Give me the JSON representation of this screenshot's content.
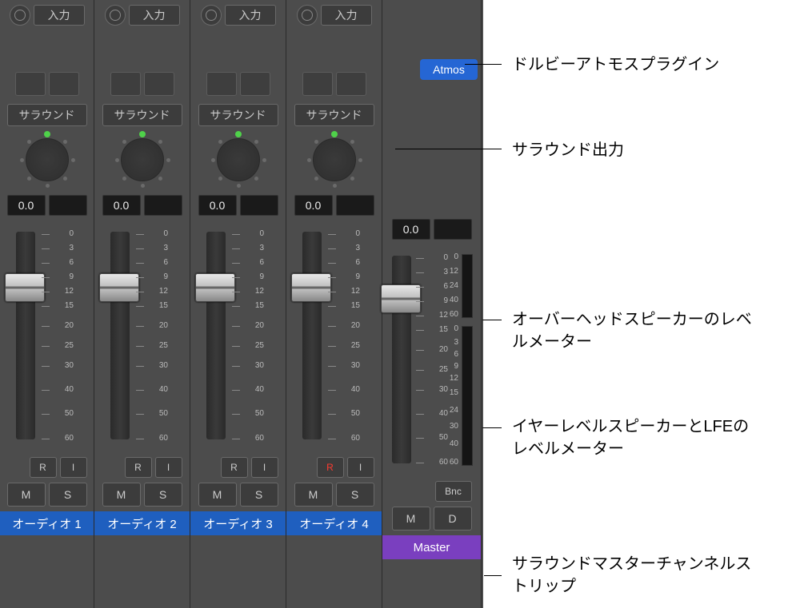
{
  "top": {
    "input_label": "入力"
  },
  "surround_label": "サラウンド",
  "gain_value": "0.0",
  "atmos_label": "Atmos",
  "scale_marks": [
    "0",
    "3",
    "6",
    "9",
    "12",
    "15",
    "20",
    "25",
    "30",
    "40",
    "50",
    "60"
  ],
  "master_scale_top": [
    "0",
    "12",
    "24",
    "40",
    "60"
  ],
  "master_scale_bottom": [
    "0",
    "3",
    "6",
    "9",
    "12",
    "15",
    "24",
    "30",
    "40",
    "60"
  ],
  "buttons": {
    "R": "R",
    "I": "I",
    "M": "M",
    "S": "S",
    "D": "D",
    "Bnc": "Bnc"
  },
  "names": {
    "audio1": "オーディオ 1",
    "audio2": "オーディオ 2",
    "audio3": "オーディオ 3",
    "audio4": "オーディオ 4",
    "master": "Master"
  },
  "callouts": {
    "atmos": "ドルビーアトモスプラグイン",
    "surround": "サラウンド出力",
    "overhead": "オーバーヘッドスピーカーのレベルメーター",
    "earlevel": "イヤーレベルスピーカーとLFEのレベルメーター",
    "masterstrip": "サラウンドマスターチャンネルストリップ"
  }
}
